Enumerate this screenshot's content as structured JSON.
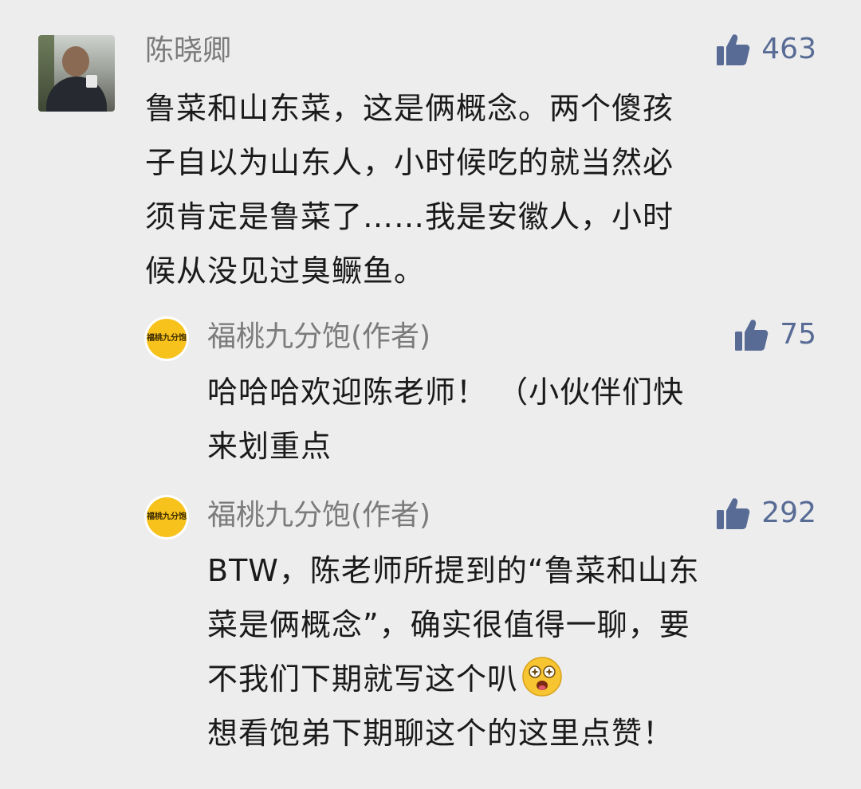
{
  "comments": [
    {
      "author": "陈晓卿",
      "likes": "463",
      "lines": [
        "鲁菜和山东菜，这是俩概念。两个傻孩",
        "子自以为山东人，小时候吃的就当然必",
        "须肯定是鲁菜了……我是安徽人，小时",
        "候从没见过臭鳜鱼。"
      ]
    }
  ],
  "replies": [
    {
      "author": "福桃九分饱(作者)",
      "avatar_text": "福桃九分饱",
      "likes": "75",
      "lines": [
        "哈哈哈欢迎陈老师！ （小伙伴们快",
        "来划重点"
      ]
    },
    {
      "author": "福桃九分饱(作者)",
      "avatar_text": "福桃九分饱",
      "likes": "292",
      "lines": [
        "BTW，陈老师所提到的“鲁菜和山东",
        "菜是俩概念”，确实很值得一聊，要",
        "不我们下期就写这个叭",
        "想看饱弟下期聊这个的这里点赞！"
      ],
      "emoji": "star-eyes-emoji"
    }
  ],
  "colors": {
    "background": "#ededed",
    "name": "#7b7b7b",
    "like": "#576b95",
    "text": "#1a1a1a",
    "avatar_yellow": "#f8c21c"
  },
  "icons": {
    "like": "thumbs-up-icon"
  }
}
